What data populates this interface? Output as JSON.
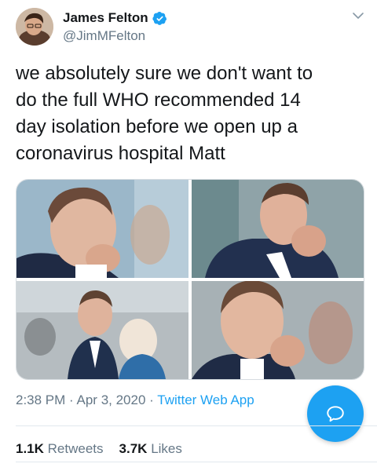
{
  "author": {
    "name": "James Felton",
    "handle": "@JimMFelton"
  },
  "tweet": {
    "lines": [
      "we absolutely sure we don't want to",
      "do the full WHO recommended 14",
      "day isolation before we open up a",
      "coronavirus hospital Matt"
    ]
  },
  "meta": {
    "time": "2:38 PM",
    "separator": "·",
    "date": "Apr 3, 2020",
    "app": "Twitter Web App"
  },
  "stats": {
    "retweets_count": "1.1K",
    "retweets_label": "Retweets",
    "likes_count": "3.7K",
    "likes_label": "Likes"
  },
  "icons": {
    "verified": "verified-badge-icon",
    "caret": "chevron-down-icon",
    "reply": "reply-icon"
  },
  "colors": {
    "accent": "#1da1f2",
    "secondary_text": "#657786",
    "primary_text": "#14171a"
  }
}
